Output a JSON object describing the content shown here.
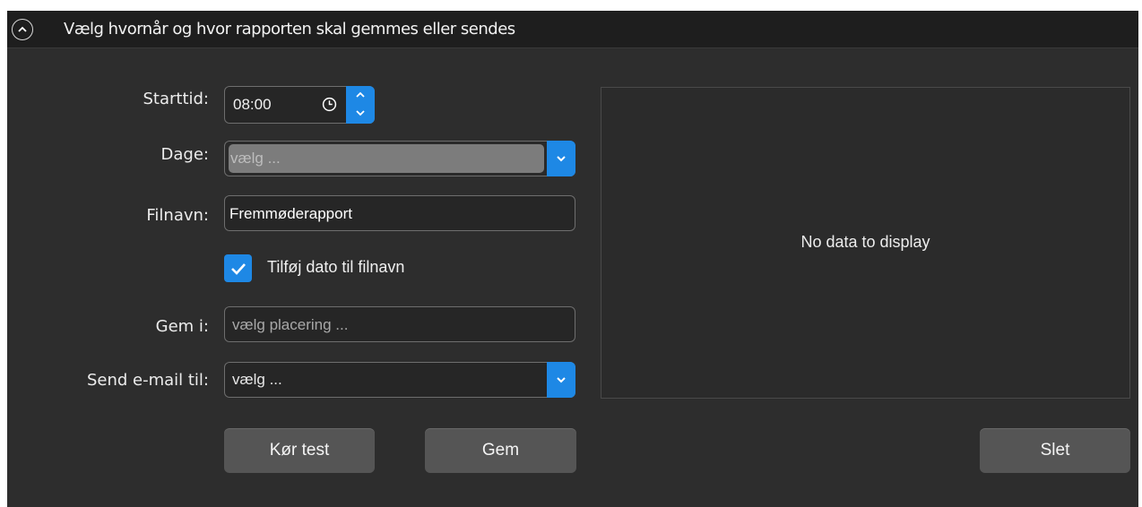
{
  "header": {
    "title": "Vælg hvornår og hvor rapporten skal gemmes eller sendes"
  },
  "form": {
    "start_label": "Starttid:",
    "start_value": "08:00",
    "days_label": "Dage:",
    "days_placeholder": "vælg ...",
    "filename_label": "Filnavn:",
    "filename_value": "Fremmøderapport",
    "add_date_checked": true,
    "add_date_label": "Tilføj dato til filnavn",
    "save_in_label": "Gem i:",
    "save_in_placeholder": "vælg placering ...",
    "email_label": "Send e-mail til:",
    "email_placeholder": "vælg ..."
  },
  "buttons": {
    "run_test": "Kør test",
    "save": "Gem",
    "delete": "Slet"
  },
  "preview": {
    "message": "No data to display"
  },
  "colors": {
    "accent": "#1e88e5",
    "panel": "#2d2d2d",
    "header": "#1e1e1e",
    "button": "#555555"
  },
  "icons": [
    "chevron-up-icon",
    "clock-icon",
    "spin-up-icon",
    "spin-down-icon",
    "chevron-down-icon",
    "checkmark-icon"
  ]
}
